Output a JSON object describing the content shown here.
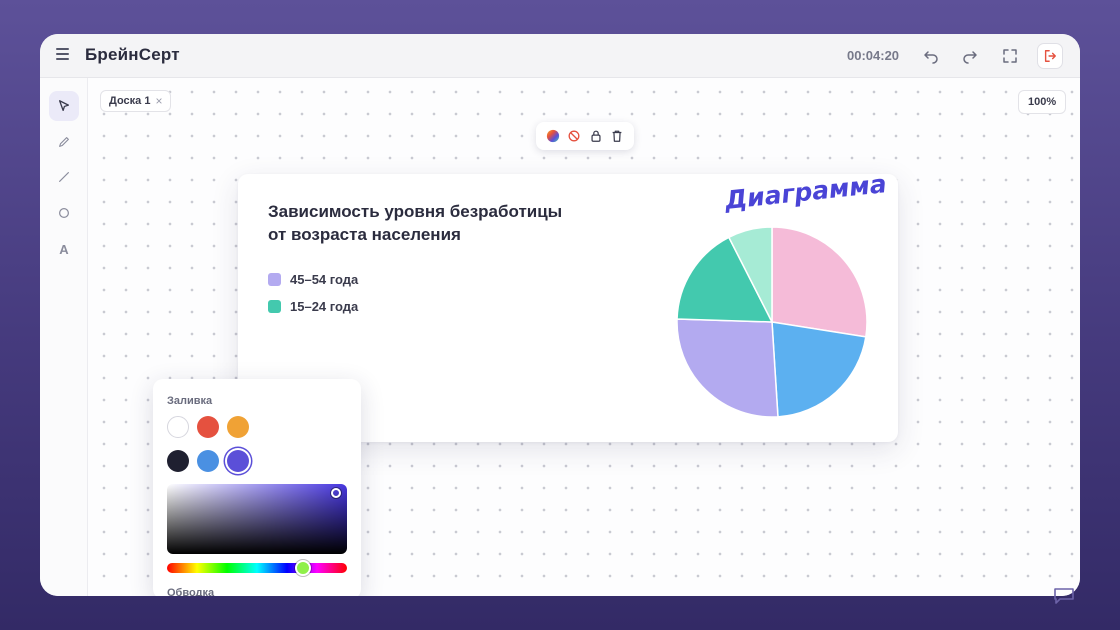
{
  "app": {
    "title": "БрейнСерт",
    "timer": "00:04:20"
  },
  "board": {
    "tab_label": "Доска 1",
    "tab_close": "×",
    "zoom": "100%"
  },
  "tools": [
    {
      "name": "select",
      "active": true
    },
    {
      "name": "pencil",
      "active": false
    },
    {
      "name": "line",
      "active": false
    },
    {
      "name": "ellipse",
      "active": false
    },
    {
      "name": "text",
      "label": "A",
      "active": false
    }
  ],
  "card": {
    "title": "Зависимость уровня безработицы от возраста населения",
    "badge": "Диаграмма"
  },
  "chart_data": {
    "type": "pie",
    "title": "Зависимость уровня безработицы от возраста населения",
    "legend": [
      {
        "label": "45–54 года",
        "color": "#b3aaf0"
      },
      {
        "label": "15–24 года",
        "color": "#43c9ae"
      }
    ],
    "slices": [
      {
        "value": 27.5,
        "color": "#f5bbd8"
      },
      {
        "value": 21.5,
        "color": "#5cb0f0"
      },
      {
        "value": 26.5,
        "color": "#b3aaf0"
      },
      {
        "value": 17.0,
        "color": "#43c9ae"
      },
      {
        "value": 7.5,
        "color": "#a6ebd5"
      }
    ],
    "start_angle_deg": 0,
    "legend_position": "left"
  },
  "color_panel": {
    "fill_label": "Заливка",
    "stroke_label": "Обводка",
    "swatches": [
      "#ffffff",
      "#e5513f",
      "#f0a235",
      "#1f2030",
      "#4a90e2",
      "#5b4fd8"
    ],
    "selected_color": "#5b4fd8"
  },
  "colors": {
    "accent": "#5b4fd8",
    "exit": "#e5513f",
    "badge": "#4a44d6"
  }
}
